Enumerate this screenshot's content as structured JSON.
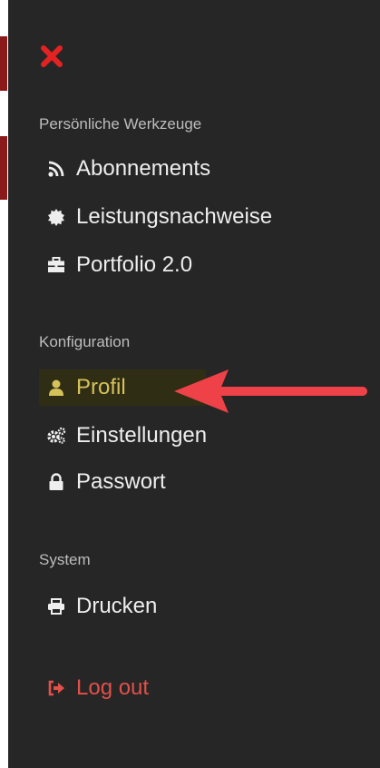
{
  "sections": {
    "personal": {
      "title": "Persönliche Werkzeuge",
      "items": [
        {
          "label": "Abonnements",
          "icon": "rss-icon"
        },
        {
          "label": "Leistungsnachweise",
          "icon": "certificate-icon"
        },
        {
          "label": "Portfolio 2.0",
          "icon": "briefcase-icon"
        }
      ]
    },
    "config": {
      "title": "Konfiguration",
      "items": [
        {
          "label": "Profil",
          "icon": "user-icon",
          "active": true
        },
        {
          "label": "Einstellungen",
          "icon": "cogs-icon"
        },
        {
          "label": "Passwort",
          "icon": "lock-icon"
        }
      ]
    },
    "system": {
      "title": "System",
      "items": [
        {
          "label": "Drucken",
          "icon": "print-icon"
        }
      ]
    }
  },
  "logout": {
    "label": "Log out",
    "icon": "sign-out-icon"
  },
  "colors": {
    "panel_bg": "#262626",
    "text": "#eeeeee",
    "section_title": "#bdbdbd",
    "active_text": "#d6c25a",
    "active_bg": "#2f2d14",
    "logout": "#e2504a",
    "close": "#e32222",
    "annotation_arrow": "#ee4148"
  }
}
